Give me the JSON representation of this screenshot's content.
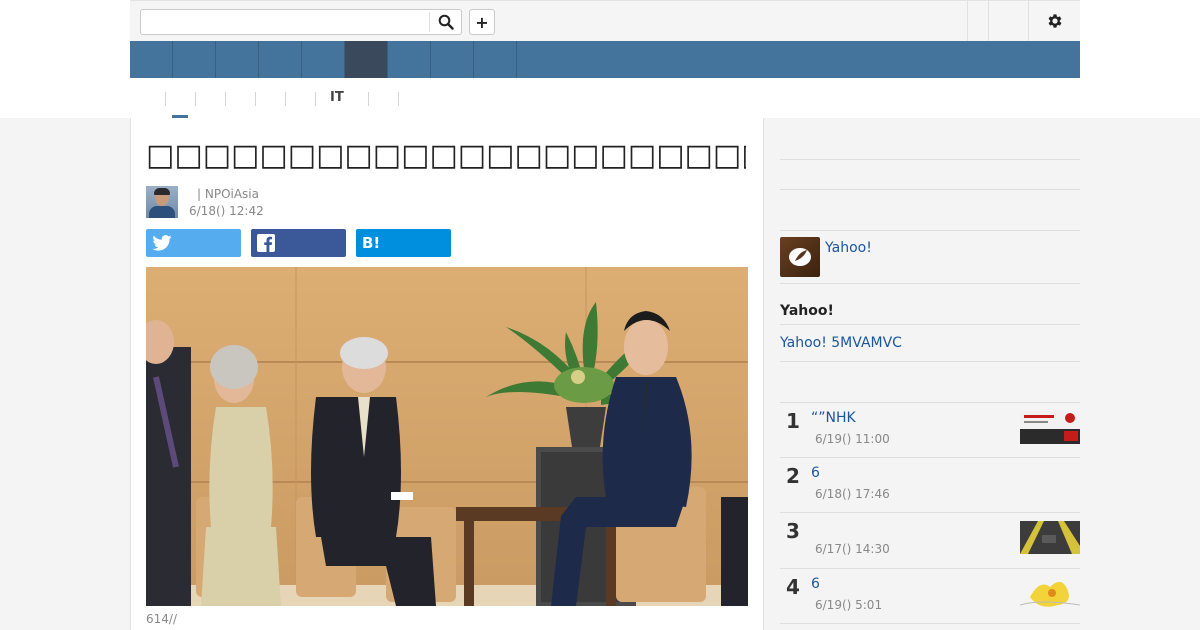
{
  "search": {
    "placeholder": "",
    "value": ""
  },
  "icons": {
    "search": "search-icon",
    "add": "plus-icon",
    "settings": "gear-icon",
    "twitter": "twitter-icon",
    "facebook": "facebook-icon",
    "hatena": "hatena-bookmark-icon",
    "yahoo_author": "quill-icon"
  },
  "header": {
    "add_label": "+"
  },
  "subnav": {
    "it_label": "IT"
  },
  "article": {
    "title": "□□□□□□□□□□□□□□□□□□□□□□□□□□□□□□",
    "author": "| NPOiAsia",
    "date": "6/18() 12:42",
    "caption": "614//",
    "share": {
      "hatena_label": "B!"
    }
  },
  "sidebar": {
    "yahoo_link": "Yahoo!",
    "heading": "Yahoo!",
    "link2": "Yahoo! 5MVAMVC",
    "ranking": [
      {
        "rank": "1",
        "title": "“”NHK",
        "date": "6/19() 11:00"
      },
      {
        "rank": "2",
        "title": "6",
        "date": "6/18() 17:46"
      },
      {
        "rank": "3",
        "title": "",
        "date": "6/17() 14:30"
      },
      {
        "rank": "4",
        "title": "6",
        "date": "6/19() 5:01"
      }
    ]
  },
  "colors": {
    "nav": "#44739b",
    "nav_active": "#3a4a5c",
    "twitter": "#55acee",
    "facebook": "#3b5998",
    "hatena": "#008fde",
    "link": "#1a56a0"
  }
}
